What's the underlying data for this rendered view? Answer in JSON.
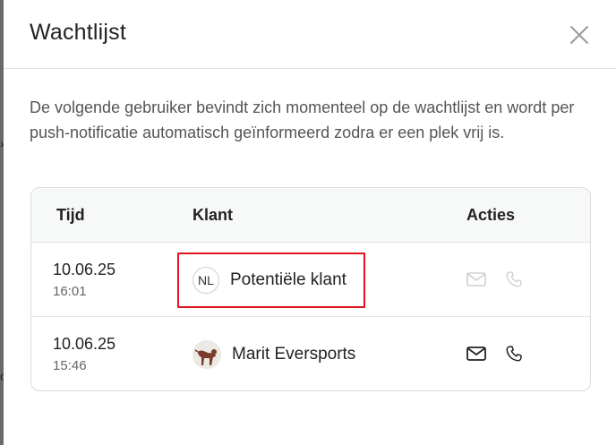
{
  "modal": {
    "title": "Wachtlijst",
    "description": "De volgende gebruiker bevindt zich momenteel op de wachtlijst en wordt per push-notificatie automatisch geïnformeerd zodra er een plek vrij is."
  },
  "table": {
    "headers": {
      "time": "Tijd",
      "client": "Klant",
      "actions": "Acties"
    },
    "rows": [
      {
        "date": "10.06.25",
        "time": "16:01",
        "initials": "NL",
        "name": "Potentiële klant",
        "actions_enabled": false
      },
      {
        "date": "10.06.25",
        "time": "15:46",
        "initials": "",
        "name": "Marit Eversports",
        "actions_enabled": true
      }
    ]
  },
  "icons": {
    "close": "close-icon",
    "mail": "mail-icon",
    "phone": "phone-icon"
  },
  "colors": {
    "highlight": "#e0141c",
    "disabled_icon": "#cfcfcf",
    "enabled_icon": "#222222"
  }
}
